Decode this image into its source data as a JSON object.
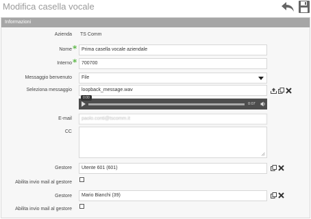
{
  "header": {
    "title": "Modifica casella vocale",
    "back_icon": "back-arrow-icon",
    "save_icon": "floppy-disk-icon"
  },
  "section": {
    "title": "Informazioni"
  },
  "form": {
    "azienda": {
      "label": "Azienda",
      "value": "TS Comm"
    },
    "nome": {
      "label": "Nome",
      "value": "Prima casella vocale aziendale",
      "required": true
    },
    "interno": {
      "label": "Interno",
      "value": "700700",
      "required": true
    },
    "messaggio_benvenuto": {
      "label": "Messaggio benvenuto",
      "value": "File"
    },
    "seleziona_messaggio": {
      "label": "Seleziona messaggio",
      "value": "loopback_message.wav",
      "icons": [
        "upload-icon",
        "copy-icon",
        "delete-icon"
      ]
    },
    "audio_player": {
      "current_time": "0:00",
      "duration": "0:07",
      "progress": 0
    },
    "email": {
      "label": "E-mail",
      "value": "paolo.conti@tscomm.it"
    },
    "cc": {
      "label": "CC",
      "value": ""
    },
    "gestore_1": {
      "label": "Gestore",
      "value": "Utente 601 (601)"
    },
    "abilita_1": {
      "label": "Abilita invio mail al gestore",
      "checked": false
    },
    "gestore_2": {
      "label": "Gestore",
      "value": "Mario Bianchi (39)"
    },
    "abilita_2": {
      "label": "Abilita invio mail al gestore",
      "checked": false
    }
  },
  "colors": {
    "required_star": "#5fb94a",
    "section_bar": "#a6a6a6",
    "audio_bg": "#4d4d4d"
  }
}
